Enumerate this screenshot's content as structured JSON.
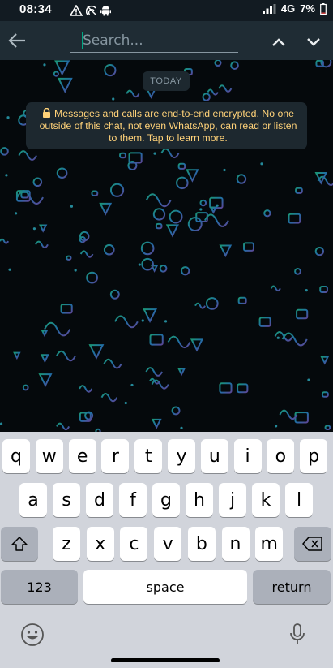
{
  "status_bar": {
    "time": "08:34",
    "network": "4G",
    "battery": "7%",
    "left_icons": [
      "warning-icon",
      "signal-off-icon",
      "android-icon"
    ]
  },
  "search": {
    "placeholder": "Search...",
    "value": ""
  },
  "chat": {
    "date_label": "TODAY",
    "encryption_notice": "Messages and calls are end-to-end encrypted. No one outside of this chat, not even WhatsApp, can read or listen to them. Tap to learn more."
  },
  "keyboard": {
    "row1": [
      "q",
      "w",
      "e",
      "r",
      "t",
      "y",
      "u",
      "i",
      "o",
      "p"
    ],
    "row2": [
      "a",
      "s",
      "d",
      "f",
      "g",
      "h",
      "j",
      "k",
      "l"
    ],
    "row3": [
      "z",
      "x",
      "c",
      "v",
      "b",
      "n",
      "m"
    ],
    "numbers_label": "123",
    "space_label": "space",
    "return_label": "return"
  },
  "colors": {
    "header_bg": "#1f2c34",
    "notice_text": "#ffd279",
    "accent": "#00a884"
  }
}
